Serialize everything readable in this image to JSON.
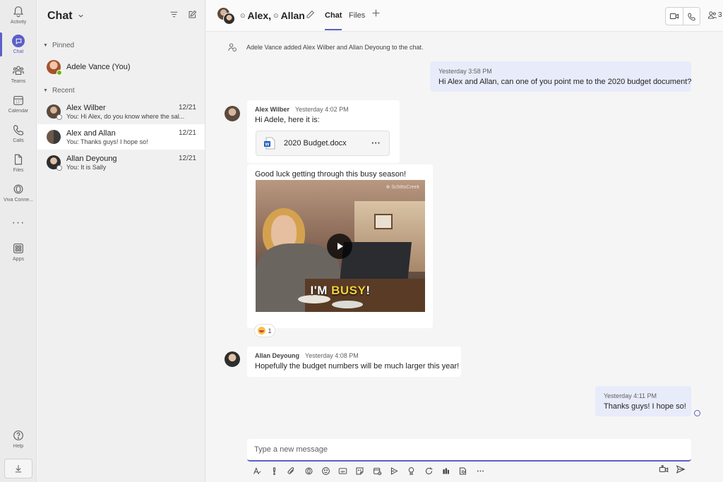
{
  "colors": {
    "accent": "#5b5fc7",
    "online": "#6bb700",
    "me_bubble": "#e8ebfa"
  },
  "rail": {
    "items": [
      {
        "label": "Activity",
        "icon": "bell-icon"
      },
      {
        "label": "Chat",
        "icon": "chat-icon"
      },
      {
        "label": "Teams",
        "icon": "teams-icon"
      },
      {
        "label": "Calendar",
        "icon": "calendar-icon"
      },
      {
        "label": "Calls",
        "icon": "phone-icon"
      },
      {
        "label": "Files",
        "icon": "file-icon"
      },
      {
        "label": "Viva Conne...",
        "icon": "viva-connections-icon"
      },
      {
        "label": "Apps",
        "icon": "apps-icon"
      },
      {
        "label": "Help",
        "icon": "help-icon"
      }
    ],
    "more": "···"
  },
  "list": {
    "title": "Chat",
    "pinned_label": "Pinned",
    "recent_label": "Recent",
    "pinned": [
      {
        "name": "Adele Vance (You)"
      }
    ],
    "recent": [
      {
        "name": "Alex Wilber",
        "preview": "You: Hi Alex, do you know where the sal...",
        "date": "12/21"
      },
      {
        "name": "Alex and Allan",
        "preview": "You: Thanks guys! I hope so!",
        "date": "12/21"
      },
      {
        "name": "Allan Deyoung",
        "preview": "You: It is Sally",
        "date": "12/21"
      }
    ]
  },
  "header": {
    "title_part1": "Alex,",
    "title_part2": "Allan",
    "tabs": [
      "Chat",
      "Files"
    ],
    "people_count": "3"
  },
  "conversation": {
    "system_message": "Adele Vance added Alex Wilber and Allan Deyoung to the chat.",
    "msg1": {
      "time": "Yesterday 3:58 PM",
      "text": "Hi Alex and Allan, can one of you point me to the 2020 budget document?"
    },
    "msg2": {
      "sender": "Alex Wilber",
      "time": "Yesterday 4:02 PM",
      "text": "Hi Adele, here it is:",
      "file_name": "2020 Budget.docx",
      "file_more": "···"
    },
    "msg3": {
      "text": "Good luck getting through this busy season!",
      "gif_caption_a": "I'M ",
      "gif_caption_b": "BUSY",
      "gif_caption_c": "!",
      "gif_watermark": "⊕ SchittsCreek",
      "reaction_count": "1"
    },
    "msg4": {
      "sender": "Allan Deyoung",
      "time": "Yesterday 4:08 PM",
      "text": "Hopefully the budget numbers will be much larger this year!"
    },
    "msg5": {
      "time": "Yesterday 4:11 PM",
      "text": "Thanks guys! I hope so!"
    }
  },
  "compose": {
    "placeholder": "Type a new message",
    "tools": [
      "format-icon",
      "important-icon",
      "attach-icon",
      "loop-icon",
      "emoji-icon",
      "gif-icon",
      "sticker-icon",
      "schedule-meeting-icon",
      "stream-icon",
      "praise-icon",
      "refresh-icon",
      "approvals-icon",
      "updates-icon",
      "more-icon"
    ]
  }
}
